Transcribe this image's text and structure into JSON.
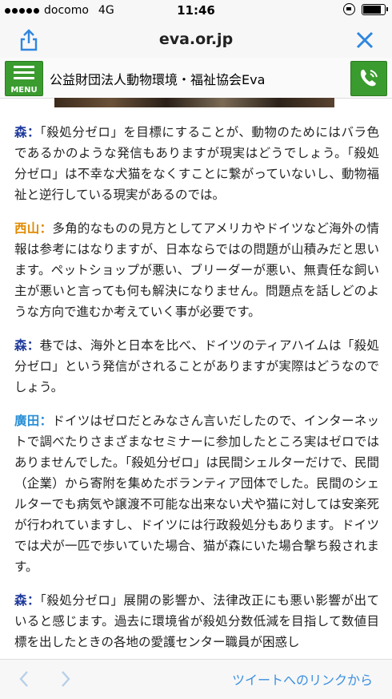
{
  "status": {
    "carrier": "docomo",
    "network": "4G",
    "time": "11:46"
  },
  "browser": {
    "url": "eva.or.jp",
    "share_icon": "share-icon",
    "close_icon": "close-icon"
  },
  "site": {
    "menu_label": "MENU",
    "title": "公益財団法人動物環境・福祉協会Eva",
    "accent": "#3a9b2e"
  },
  "article": {
    "paragraphs": [
      {
        "speaker": "森：",
        "text": "「殺処分ゼロ」を目標にすることが、動物のためにはバラ色であるかのような発信もありますが現実はどうでしょう。「殺処分ゼロ」は不幸な犬猫をなくすことに繋がっていないし、動物福祉と逆行している現実があるのでは。"
      },
      {
        "speaker": "西山：",
        "text": "多角的なものの見方としてアメリカやドイツなど海外の情報は参考にはなりますが、日本ならではの問題が山積みだと思います。ペットショップが悪い、ブリーダーが悪い、無責任な飼い主が悪いと言っても何も解決になりません。問題点を話しどのような方向で進むか考えていく事が必要です。"
      },
      {
        "speaker": "森：",
        "text": "巷では、海外と日本を比べ、ドイツのティアハイムは「殺処分ゼロ」という発信がされることがありますが実際はどうなのでしょう。"
      },
      {
        "speaker": "廣田：",
        "text": "ドイツはゼロだとみなさん言いだしたので、インターネットで調べたりさまざまなセミナーに参加したところ実はゼロではありませんでした。「殺処分ゼロ」は民間シェルターだけで、民間（企業）から寄附を集めたボランティア団体でした。民間のシェルターでも病気や譲渡不可能な出来ない犬や猫に対しては安楽死が行われていますし、ドイツには行政殺処分もあります。ドイツでは犬が一匹で歩いていた場合、猫が森にいた場合撃ち殺されます。"
      },
      {
        "speaker": "森：",
        "text": "「殺処分ゼロ」展開の影響か、法律改正にも悪い影響が出ていると感じます。過去に環境省が殺処分数低減を目指して数値目標を出したときの各地の愛護センター職員が困惑し"
      }
    ]
  },
  "toolbar": {
    "back_icon": "chevron-left-icon",
    "forward_icon": "chevron-right-icon",
    "tweet_link": "ツイートへのリンクから"
  }
}
